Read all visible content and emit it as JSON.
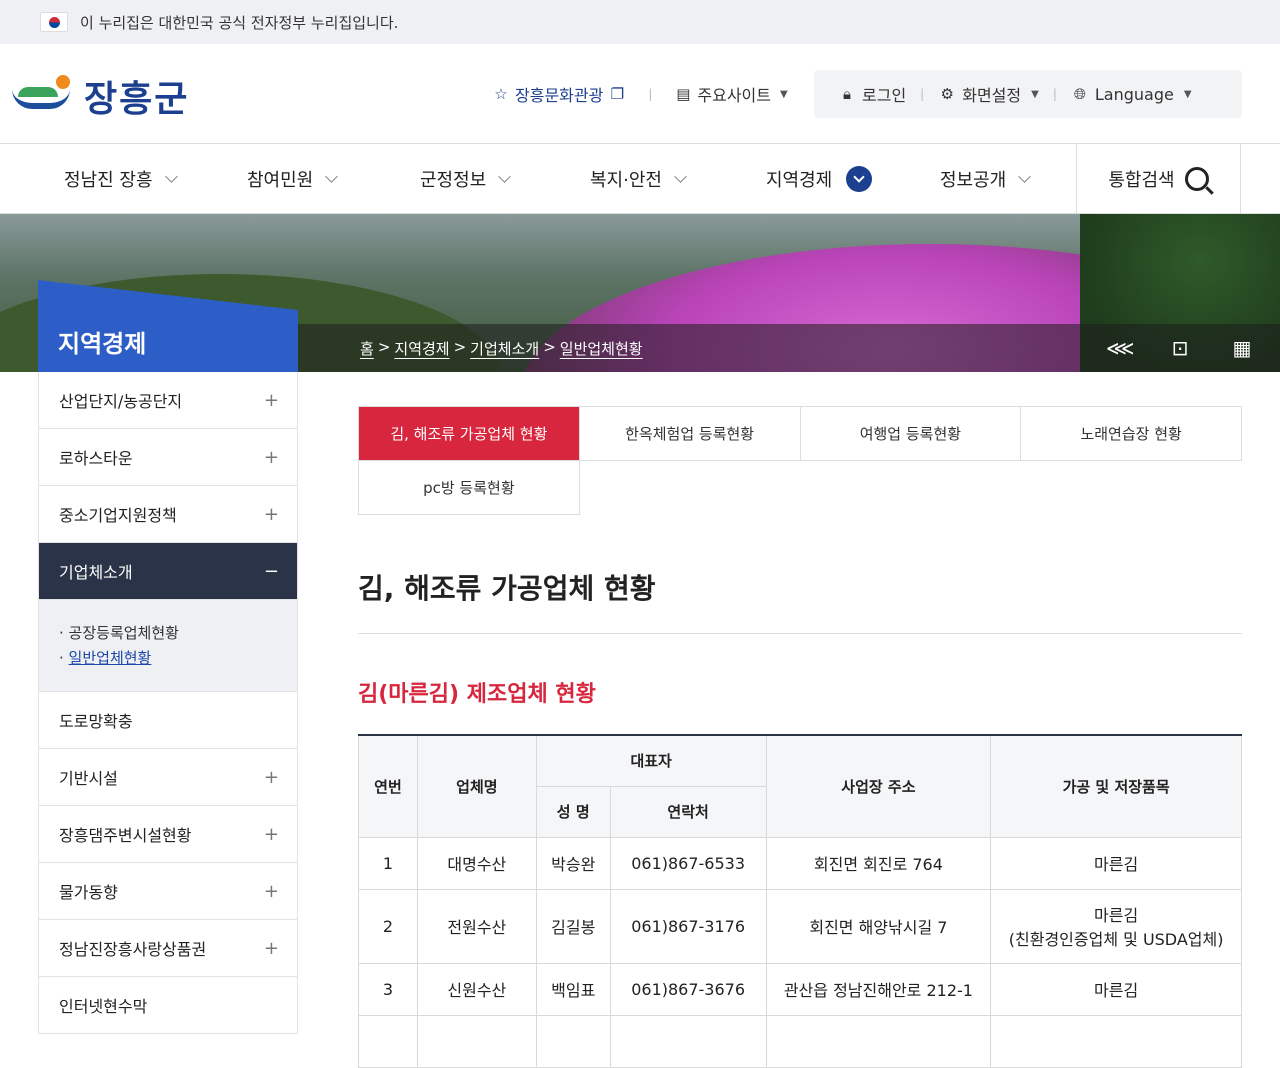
{
  "gov_banner": {
    "text": "이 누리집은 대한민국 공식 전자정부 누리집입니다."
  },
  "logo": {
    "text": "장흥군"
  },
  "utility": {
    "culture": "장흥문화관광",
    "main_sites": "주요사이트",
    "login": "로그인",
    "display_settings": "화면설정",
    "language": "Language"
  },
  "gnb": {
    "items": [
      {
        "label": "정남진 장흥"
      },
      {
        "label": "참여민원"
      },
      {
        "label": "군정정보"
      },
      {
        "label": "복지·안전"
      },
      {
        "label": "지역경제"
      },
      {
        "label": "정보공개"
      }
    ],
    "search_label": "통합검색"
  },
  "breadcrumb": {
    "home": "홈",
    "level1": "지역경제",
    "level2": "기업체소개",
    "level3": "일반업체현황"
  },
  "lnb": {
    "title": "지역경제",
    "items": [
      {
        "label": "산업단지/농공단지",
        "toggle": "+"
      },
      {
        "label": "로하스타운",
        "toggle": "+"
      },
      {
        "label": "중소기업지원정책",
        "toggle": "+"
      },
      {
        "label": "기업체소개",
        "toggle": "−"
      },
      {
        "label": "도로망확충",
        "toggle": ""
      },
      {
        "label": "기반시설",
        "toggle": "+"
      },
      {
        "label": "장흥댐주변시설현황",
        "toggle": "+"
      },
      {
        "label": "물가동향",
        "toggle": "+"
      },
      {
        "label": "정남진장흥사랑상품권",
        "toggle": "+"
      },
      {
        "label": "인터넷현수막",
        "toggle": ""
      }
    ],
    "sub_items": [
      {
        "label": "공장등록업체현황"
      },
      {
        "label": "일반업체현황"
      }
    ]
  },
  "tabs": [
    {
      "label": "김, 해조류 가공업체 현황"
    },
    {
      "label": "한옥체험업 등록현황"
    },
    {
      "label": "여행업 등록현황"
    },
    {
      "label": "노래연습장 현황"
    },
    {
      "label": "pc방 등록현황"
    }
  ],
  "page_title": "김, 해조류 가공업체 현황",
  "section_title": "김(마른김) 제조업체 현황",
  "table": {
    "headers": {
      "no": "연번",
      "company": "업체명",
      "rep": "대표자",
      "rep_name": "성 명",
      "rep_contact": "연락처",
      "address": "사업장 주소",
      "products": "가공 및 저장품목"
    },
    "rows": [
      {
        "no": "1",
        "company": "대명수산",
        "name": "박승완",
        "contact": "061)867-6533",
        "address": "회진면 회진로 764",
        "product": "마른김",
        "product_note": ""
      },
      {
        "no": "2",
        "company": "전원수산",
        "name": "김길봉",
        "contact": "061)867-3176",
        "address": "회진면 해양낚시길 7",
        "product": "마른김",
        "product_note": "(친환경인증업체 및 USDA업체)"
      },
      {
        "no": "3",
        "company": "신원수산",
        "name": "백임표",
        "contact": "061)867-3676",
        "address": "관산읍 정남진해안로 212-1",
        "product": "마른김",
        "product_note": ""
      }
    ]
  },
  "colors": {
    "brand_blue": "#1c3f8f",
    "accent_red": "#d7263d",
    "lnb_blue": "#2d5ec8",
    "active_dark": "#2a3347"
  }
}
